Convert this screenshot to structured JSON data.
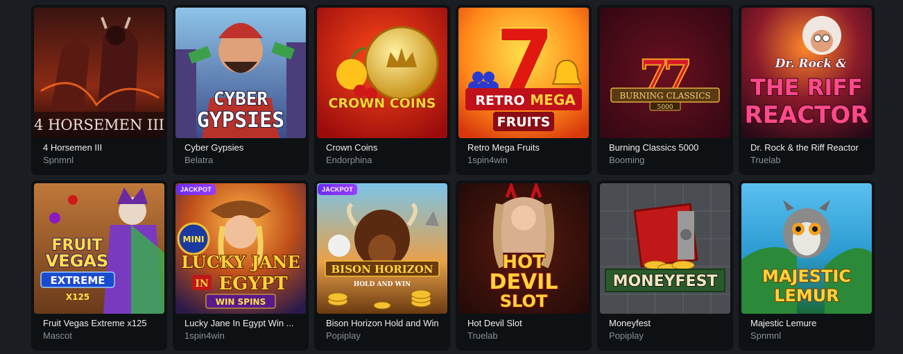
{
  "games": [
    {
      "title": "4 Horsemen III",
      "provider": "Spnmnl",
      "art_text": [
        "4 HORSEMEN III"
      ]
    },
    {
      "title": "Cyber Gypsies",
      "provider": "Belatra",
      "art_text": [
        "CYBER",
        "GYPSIES"
      ]
    },
    {
      "title": "Crown Coins",
      "provider": "Endorphina",
      "art_text": [
        "CROWN COINS"
      ]
    },
    {
      "title": "Retro Mega Fruits",
      "provider": "1spin4win",
      "art_text": [
        "RETRO",
        "MEGA",
        "FRUITS"
      ]
    },
    {
      "title": "Burning Classics 5000",
      "provider": "Booming",
      "art_text": [
        "BURNING CLASSICS",
        "5000"
      ]
    },
    {
      "title": "Dr. Rock & the Riff Reactor",
      "provider": "Truelab",
      "art_text": [
        "Dr. Rock &",
        "THE RIFF",
        "REACTOR"
      ]
    },
    {
      "title": "Fruit Vegas Extreme x125",
      "provider": "Mascot",
      "art_text": [
        "FRUIT",
        "VEGAS",
        "EXTREME",
        "X125"
      ]
    },
    {
      "title": "Lucky Jane In Egypt Win ...",
      "provider": "1spin4win",
      "badge": "JACKPOT",
      "art_text": [
        "MINI",
        "LUCKY JANE",
        "IN",
        "EGYPT",
        "WIN SPINS"
      ]
    },
    {
      "title": "Bison Horizon Hold and Win",
      "provider": "Popiplay",
      "badge": "JACKPOT",
      "art_text": [
        "BISON HORIZON",
        "HOLD AND WIN"
      ]
    },
    {
      "title": "Hot Devil Slot",
      "provider": "Truelab",
      "art_text": [
        "HOT",
        "DEVIL",
        "SLOT"
      ]
    },
    {
      "title": "Moneyfest",
      "provider": "Popiplay",
      "art_text": [
        "MONEYFEST"
      ]
    },
    {
      "title": "Majestic Lemure",
      "provider": "Spnmnl",
      "art_text": [
        "MAJESTIC",
        "LEMUR"
      ]
    }
  ],
  "colors": {
    "page_bg": "#1a1d21",
    "card_bg": "#0e1113",
    "title": "#eef0f2",
    "provider": "#8a9097",
    "badge": "#7b33f5"
  }
}
